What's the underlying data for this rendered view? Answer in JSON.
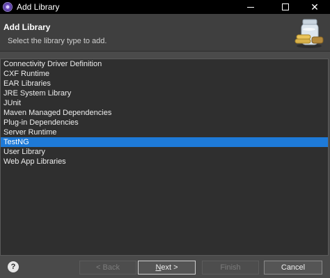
{
  "window": {
    "title": "Add Library",
    "icon": "eclipse-icon",
    "minimize_icon": "minimize-icon",
    "maximize_icon": "maximize-icon",
    "close_glyph": "✕"
  },
  "header": {
    "title": "Add Library",
    "subtitle": "Select the library type to add.",
    "image_icon": "library-jar-icon"
  },
  "library_types": [
    "Connectivity Driver Definition",
    "CXF Runtime",
    "EAR Libraries",
    "JRE System Library",
    "JUnit",
    "Maven Managed Dependencies",
    "Plug-in Dependencies",
    "Server Runtime",
    "TestNG",
    "User Library",
    "Web App Libraries"
  ],
  "selected_library": "TestNG",
  "selected_color": "#1e7ad8",
  "footer": {
    "help": "?",
    "back": "< Back",
    "next_mnemonic": "N",
    "next_rest": "ext >",
    "finish": "Finish",
    "cancel": "Cancel"
  }
}
